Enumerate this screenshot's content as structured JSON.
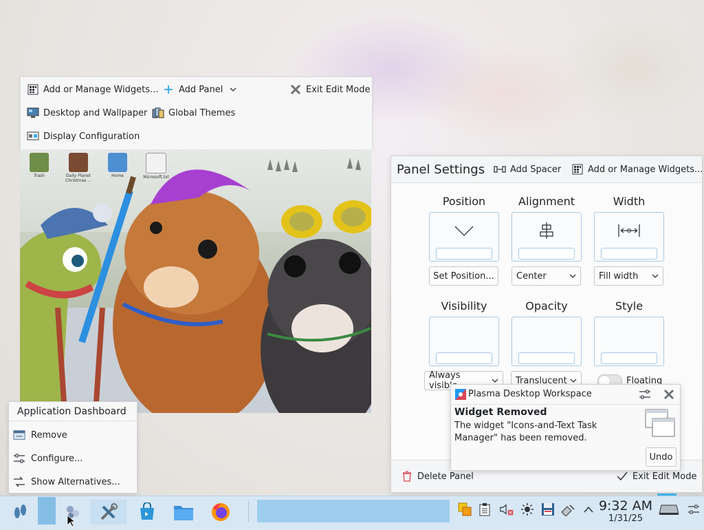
{
  "edit_toolbar": {
    "add_widgets": "Add or Manage Widgets...",
    "add_panel": "Add Panel",
    "exit_edit": "Exit Edit Mode",
    "desktop_wallpaper": "Desktop and Wallpaper",
    "global_themes": "Global Themes",
    "display_config": "Display Configuration"
  },
  "desktop_preview": {
    "icons": [
      "Trash",
      "Daily Planet Christmas ...",
      "Home",
      "Microsoft.txt"
    ]
  },
  "panel_settings": {
    "title": "Panel Settings",
    "add_spacer": "Add Spacer",
    "add_widgets": "Add or Manage Widgets...",
    "position": {
      "label": "Position",
      "control": "Set Position..."
    },
    "alignment": {
      "label": "Alignment",
      "value": "Center"
    },
    "width": {
      "label": "Width",
      "value": "Fill width"
    },
    "visibility": {
      "label": "Visibility",
      "value": "Always visible"
    },
    "opacity": {
      "label": "Opacity",
      "value": "Translucent"
    },
    "style": {
      "label": "Style",
      "toggle_label": "Floating",
      "floating": false
    },
    "delete_panel": "Delete Panel",
    "exit_edit": "Exit Edit Mode"
  },
  "notification": {
    "app": "Plasma Desktop Workspace",
    "title": "Widget Removed",
    "body": "The widget \"Icons-and-Text Task Manager\" has been removed.",
    "undo": "Undo"
  },
  "context_menu": {
    "title": "Application Dashboard",
    "items": [
      "Remove",
      "Configure...",
      "Show Alternatives..."
    ]
  },
  "taskbar": {
    "clock_time": "9:32 AM",
    "clock_date": "1/31/25"
  },
  "colors": {
    "accent": "#3daee9",
    "taskbar_bg": "#d7e7f4",
    "panel_bg": "#f4f5f6"
  }
}
